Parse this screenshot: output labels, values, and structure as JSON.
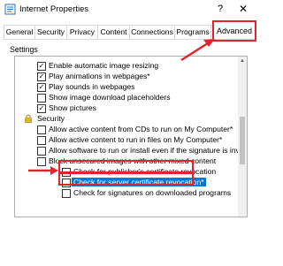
{
  "window": {
    "title": "Internet Properties",
    "help_glyph": "?",
    "close_glyph": "✕",
    "app_icon": "internet-options-icon"
  },
  "tabs": [
    {
      "label": "General"
    },
    {
      "label": "Security"
    },
    {
      "label": "Privacy"
    },
    {
      "label": "Content"
    },
    {
      "label": "Connections"
    },
    {
      "label": "Programs"
    },
    {
      "label": "Advanced"
    }
  ],
  "settings_label": "Settings",
  "settings_items": [
    {
      "label": "Enable automatic image resizing",
      "checked": true
    },
    {
      "label": "Play animations in webpages*",
      "checked": true
    },
    {
      "label": "Play sounds in webpages",
      "checked": true
    },
    {
      "label": "Show image download placeholders",
      "checked": false
    },
    {
      "label": "Show pictures",
      "checked": true
    },
    {
      "label": "Security",
      "group": true,
      "icon": "lock-icon"
    },
    {
      "label": "Allow active content from CDs to run on My Computer*",
      "checked": false
    },
    {
      "label": "Allow active content to run in files on My Computer*",
      "checked": false
    },
    {
      "label": "Allow software to run or install even if the signature is inva",
      "checked": false
    },
    {
      "label": "Block unsecured images with other mixed content",
      "checked": false
    },
    {
      "label": "Check for publisher's certificate revocation",
      "checked": false
    },
    {
      "label": "Check for server certificate revocation*",
      "checked": false,
      "selected": true
    },
    {
      "label": "Check for signatures on downloaded programs",
      "checked": false
    }
  ],
  "colors": {
    "highlight": "#e1242a",
    "selection": "#0078d7"
  },
  "check_glyph": "✓"
}
